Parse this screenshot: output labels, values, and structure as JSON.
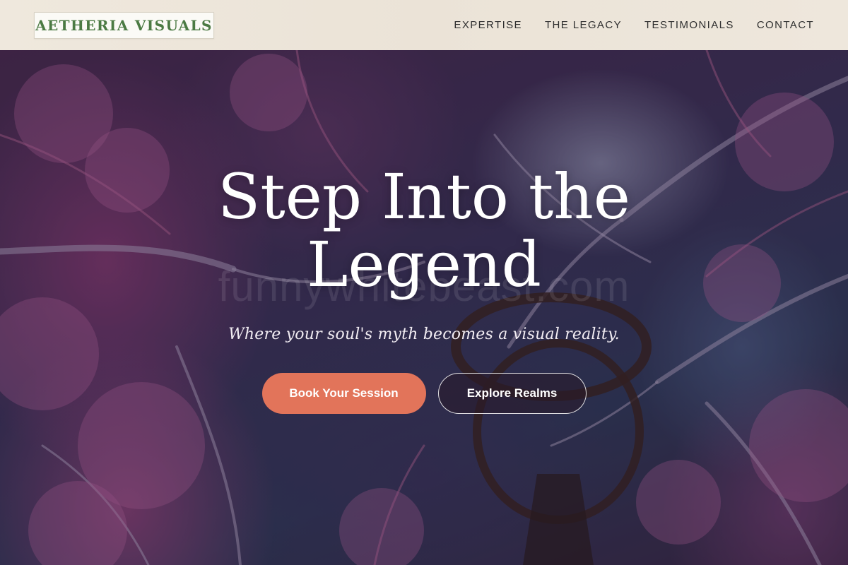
{
  "brand": {
    "logo_text": "AETHERIA VISUALS",
    "logo_color": "#4b7a43"
  },
  "nav": {
    "items": [
      {
        "label": "EXPERTISE"
      },
      {
        "label": "THE LEGACY"
      },
      {
        "label": "TESTIMONIALS"
      },
      {
        "label": "CONTACT"
      }
    ]
  },
  "hero": {
    "title": "Step Into the Legend",
    "subtitle": "Where your soul's myth becomes a visual reality.",
    "watermark": "funnywhitebeast.com",
    "primary_button": "Book Your Session",
    "secondary_button": "Explore Realms",
    "accent_color": "#e2745a",
    "background_image": "purple-forest-canopy-with-lantern"
  }
}
